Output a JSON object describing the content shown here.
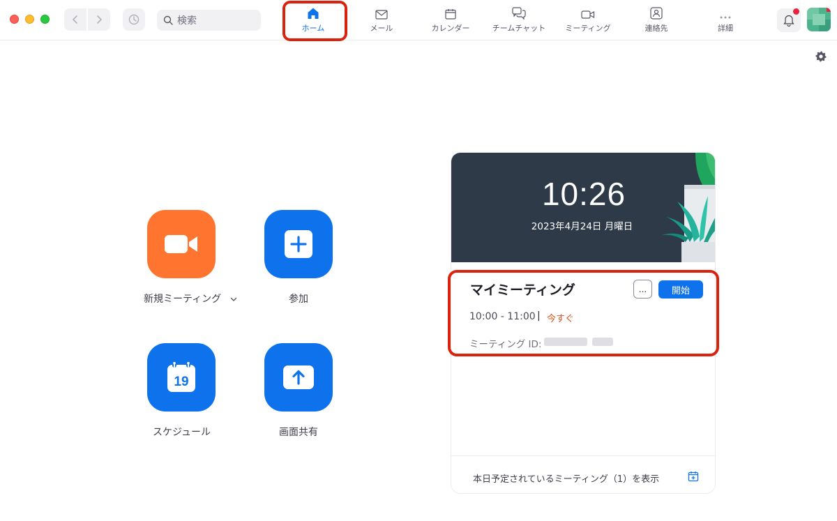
{
  "window": {
    "controls": [
      "close",
      "minimize",
      "zoom"
    ]
  },
  "toolbar": {
    "search_placeholder": "検索",
    "tabs": [
      {
        "label": "ホーム",
        "icon": "home-icon",
        "active": true
      },
      {
        "label": "メール",
        "icon": "mail-icon",
        "active": false
      },
      {
        "label": "カレンダー",
        "icon": "calendar-icon",
        "active": false
      },
      {
        "label": "チームチャット",
        "icon": "chat-icon",
        "active": false
      },
      {
        "label": "ミーティング",
        "icon": "video-icon",
        "active": false
      },
      {
        "label": "連絡先",
        "icon": "contacts-icon",
        "active": false
      },
      {
        "label": "詳細",
        "icon": "more-icon",
        "active": false
      }
    ],
    "notification_badge": true
  },
  "actions": {
    "new_meeting": {
      "label": "新規ミーティング",
      "icon": "video-camera-icon",
      "color": "#ff742e"
    },
    "join": {
      "label": "参加",
      "icon": "plus-icon",
      "color": "#0e72ed"
    },
    "schedule": {
      "label": "スケジュール",
      "icon": "calendar-19-icon",
      "day": "19",
      "color": "#0e72ed"
    },
    "share_screen": {
      "label": "画面共有",
      "icon": "upload-arrow-icon",
      "color": "#0e72ed"
    }
  },
  "card": {
    "time": "10:26",
    "date": "2023年4月24日 月曜日",
    "meeting": {
      "title": "マイミーティング",
      "more_label": "...",
      "start_label": "開始",
      "time_range": "10:00 - 11:00",
      "separator": "|",
      "status": "今すぐ",
      "id_label": "ミーティング ID:"
    },
    "footer_text": "本日予定されているミーティング（1）を表示"
  },
  "colors": {
    "accent": "#0e72ed",
    "orange": "#ff742e",
    "highlight": "#d9230f",
    "status": "#d4541a"
  }
}
